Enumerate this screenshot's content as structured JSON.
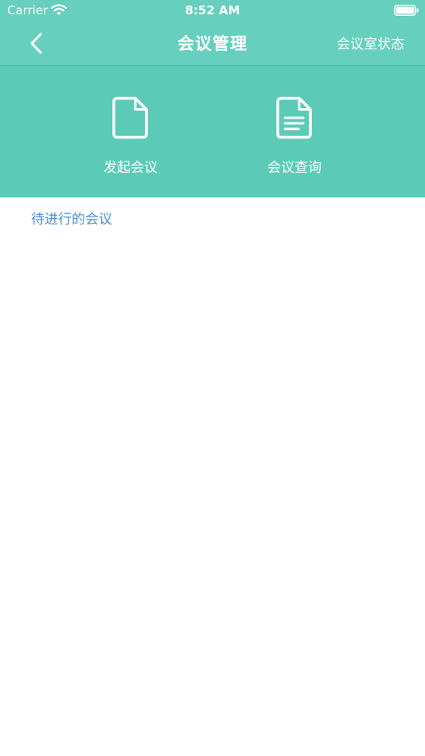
{
  "status_bar": {
    "carrier": "Carrier",
    "time": "8:52 AM",
    "wifi_icon": "wifi-icon",
    "battery_icon": "battery-full-icon"
  },
  "nav": {
    "title": "会议管理",
    "right_action": "会议室状态",
    "back_icon": "chevron-left-icon"
  },
  "actions": [
    {
      "label": "发起会议",
      "icon": "blank-document-icon"
    },
    {
      "label": "会议查询",
      "icon": "text-document-icon"
    }
  ],
  "section": {
    "title": "待进行的会议"
  },
  "colors": {
    "header_bg": "#66cfbd",
    "action_panel_bg": "#5bcbb7",
    "section_title": "#4a8fe0",
    "page_bg": "#ffffff"
  }
}
